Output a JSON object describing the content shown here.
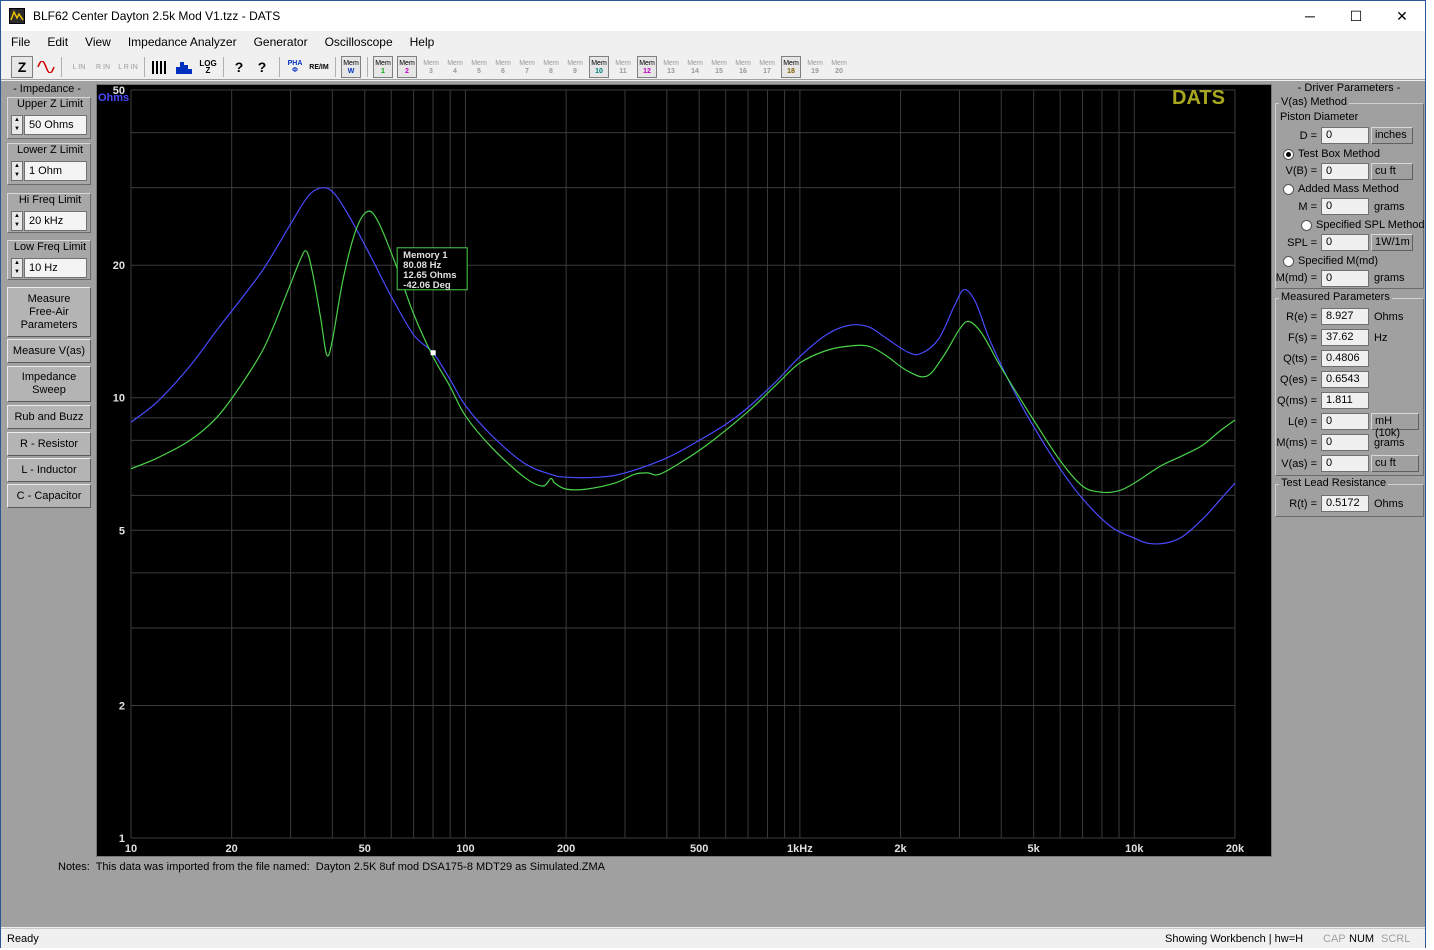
{
  "window": {
    "title": "BLF62 Center Dayton 2.5k Mod V1.tzz - DATS",
    "controls": {
      "minimize": "─",
      "maximize": "☐",
      "close": "✕"
    }
  },
  "menu": [
    "File",
    "Edit",
    "View",
    "Impedance Analyzer",
    "Generator",
    "Oscilloscope",
    "Help"
  ],
  "toolbar": {
    "z_label": "Z",
    "inputs": [
      "L IN",
      "R IN",
      "L R IN"
    ],
    "log_label": "LOG Z",
    "help_icons": [
      "?",
      "?"
    ],
    "pha_label": "PHA Φ",
    "re_im_label": "RE/IM",
    "mem_w": {
      "top": "Mem",
      "num": "W"
    },
    "mems": [
      {
        "top": "Mem",
        "num": "1",
        "active": true,
        "color": "#00a000"
      },
      {
        "top": "Mem",
        "num": "2",
        "active": true,
        "color": "#c000c0"
      },
      {
        "top": "Mem",
        "num": "3",
        "active": false,
        "color": "#9a9a9a"
      },
      {
        "top": "Mem",
        "num": "4",
        "active": false,
        "color": "#9a9a9a"
      },
      {
        "top": "Mem",
        "num": "5",
        "active": false,
        "color": "#9a9a9a"
      },
      {
        "top": "Mem",
        "num": "6",
        "active": false,
        "color": "#9a9a9a"
      },
      {
        "top": "Mem",
        "num": "7",
        "active": false,
        "color": "#9a9a9a"
      },
      {
        "top": "Mem",
        "num": "8",
        "active": false,
        "color": "#9a9a9a"
      },
      {
        "top": "Mem",
        "num": "9",
        "active": false,
        "color": "#9a9a9a"
      },
      {
        "top": "Mem",
        "num": "10",
        "active": true,
        "color": "#008080"
      },
      {
        "top": "Mem",
        "num": "11",
        "active": false,
        "color": "#9a9a9a"
      },
      {
        "top": "Mem",
        "num": "12",
        "active": true,
        "color": "#c000c0"
      },
      {
        "top": "Mem",
        "num": "13",
        "active": false,
        "color": "#9a9a9a"
      },
      {
        "top": "Mem",
        "num": "14",
        "active": false,
        "color": "#9a9a9a"
      },
      {
        "top": "Mem",
        "num": "15",
        "active": false,
        "color": "#9a9a9a"
      },
      {
        "top": "Mem",
        "num": "16",
        "active": false,
        "color": "#9a9a9a"
      },
      {
        "top": "Mem",
        "num": "17",
        "active": false,
        "color": "#9a9a9a"
      },
      {
        "top": "Mem",
        "num": "18",
        "active": true,
        "color": "#806000"
      },
      {
        "top": "Mem",
        "num": "19",
        "active": false,
        "color": "#9a9a9a"
      },
      {
        "top": "Mem",
        "num": "20",
        "active": false,
        "color": "#9a9a9a"
      }
    ]
  },
  "left_panel": {
    "header": "- Impedance -",
    "groups": [
      {
        "label": "Upper Z Limit",
        "value": "50 Ohms"
      },
      {
        "label": "Lower Z Limit",
        "value": "1 Ohm"
      },
      {
        "label": "Hi Freq Limit",
        "value": "20 kHz"
      },
      {
        "label": "Low Freq Limit",
        "value": "10 Hz"
      }
    ],
    "buttons": [
      "Measure Free-Air Parameters",
      "Measure V(as)",
      "Impedance Sweep",
      "Rub and Buzz",
      "R - Resistor",
      "L - Inductor",
      "C - Capacitor"
    ]
  },
  "right_panel": {
    "header": "- Driver Parameters -",
    "vas_method": {
      "legend": "V(as) Method",
      "piston_diameter_label": "Piston Diameter",
      "d_label": "D =",
      "d_value": "0",
      "d_unit": "inches",
      "test_box": "Test Box Method",
      "test_box_selected": true,
      "vb_label": "V(B) =",
      "vb_value": "0",
      "vb_unit": "cu ft",
      "added_mass": "Added Mass Method",
      "added_mass_selected": false,
      "m_label": "M =",
      "m_value": "0",
      "m_unit": "grams",
      "spl_method": "Specified SPL Method",
      "spl_selected": false,
      "spl_label": "SPL =",
      "spl_value": "0",
      "spl_unit": "1W/1m",
      "mmd_method": "Specified M(md)",
      "mmd_selected": false,
      "mmd_label": "M(md) =",
      "mmd_value": "0",
      "mmd_unit": "grams"
    },
    "measured": {
      "legend": "Measured Parameters",
      "rows": [
        {
          "label": "R(e) =",
          "value": "8.927",
          "unit": "Ohms",
          "unit_box": false
        },
        {
          "label": "F(s) =",
          "value": "37.62",
          "unit": "Hz",
          "unit_box": false
        },
        {
          "label": "Q(ts) =",
          "value": "0.4806",
          "unit": "",
          "unit_box": false
        },
        {
          "label": "Q(es) =",
          "value": "0.6543",
          "unit": "",
          "unit_box": false
        },
        {
          "label": "Q(ms) =",
          "value": "1.811",
          "unit": "",
          "unit_box": false
        },
        {
          "label": "L(e) =",
          "value": "0",
          "unit": "mH (10k)",
          "unit_box": true
        },
        {
          "label": "M(ms) =",
          "value": "0",
          "unit": "grams",
          "unit_box": false
        },
        {
          "label": "V(as) =",
          "value": "0",
          "unit": "cu ft",
          "unit_box": true
        }
      ]
    },
    "lead": {
      "legend": "Test Lead Resistance",
      "label": "R(t) =",
      "value": "0.5172",
      "unit": "Ohms"
    }
  },
  "notes": "Notes:  This data was imported from the file named:  Dayton 2.5K 8uf mod DSA175-8 MDT29 as Simulated.ZMA",
  "status": {
    "left": "Ready",
    "workbench": "Showing Workbench | hw=H",
    "indicators": [
      {
        "label": "CAP",
        "on": false
      },
      {
        "label": "NUM",
        "on": true
      },
      {
        "label": "SCRL",
        "on": false
      }
    ]
  },
  "chart_data": {
    "type": "line",
    "watermark": "DATS",
    "ylabel": "Ohms",
    "xscale": "log",
    "yscale": "log",
    "xlim": [
      10,
      20000
    ],
    "ylim": [
      1,
      50
    ],
    "x_ticks": [
      {
        "value": 10,
        "label": "10"
      },
      {
        "value": 20,
        "label": "20"
      },
      {
        "value": 50,
        "label": "50"
      },
      {
        "value": 100,
        "label": "100"
      },
      {
        "value": 200,
        "label": "200"
      },
      {
        "value": 500,
        "label": "500"
      },
      {
        "value": 1000,
        "label": "1kHz"
      },
      {
        "value": 2000,
        "label": "2k"
      },
      {
        "value": 5000,
        "label": "5k"
      },
      {
        "value": 10000,
        "label": "10k"
      },
      {
        "value": 20000,
        "label": "20k"
      }
    ],
    "y_ticks": [
      {
        "value": 1,
        "label": "1"
      },
      {
        "value": 2,
        "label": "2"
      },
      {
        "value": 5,
        "label": "5"
      },
      {
        "value": 10,
        "label": "10"
      },
      {
        "value": 20,
        "label": "20"
      },
      {
        "value": 50,
        "label": "50"
      }
    ],
    "grid": true,
    "series": [
      {
        "color": "#4a4aff",
        "points": [
          [
            10,
            8.8
          ],
          [
            12,
            9.8
          ],
          [
            15,
            11.8
          ],
          [
            18,
            14.2
          ],
          [
            21,
            16.5
          ],
          [
            25,
            19.7
          ],
          [
            30,
            24.8
          ],
          [
            34,
            28.8
          ],
          [
            37.6,
            30.0
          ],
          [
            41,
            28.8
          ],
          [
            46,
            25.0
          ],
          [
            52,
            21.0
          ],
          [
            60,
            17.0
          ],
          [
            70,
            13.9
          ],
          [
            80,
            12.65
          ],
          [
            90,
            11.0
          ],
          [
            100,
            9.6
          ],
          [
            120,
            8.2
          ],
          [
            150,
            7.1
          ],
          [
            180,
            6.7
          ],
          [
            200,
            6.6
          ],
          [
            250,
            6.6
          ],
          [
            300,
            6.75
          ],
          [
            400,
            7.3
          ],
          [
            500,
            8.0
          ],
          [
            600,
            8.7
          ],
          [
            700,
            9.5
          ],
          [
            850,
            10.9
          ],
          [
            1000,
            12.4
          ],
          [
            1200,
            13.9
          ],
          [
            1400,
            14.6
          ],
          [
            1600,
            14.5
          ],
          [
            1800,
            13.7
          ],
          [
            2100,
            12.7
          ],
          [
            2300,
            12.6
          ],
          [
            2600,
            13.6
          ],
          [
            2900,
            16.2
          ],
          [
            3100,
            17.6
          ],
          [
            3350,
            16.5
          ],
          [
            3700,
            13.5
          ],
          [
            4300,
            10.6
          ],
          [
            5000,
            8.6
          ],
          [
            6000,
            6.9
          ],
          [
            7000,
            5.9
          ],
          [
            8500,
            5.1
          ],
          [
            10000,
            4.8
          ],
          [
            11000,
            4.67
          ],
          [
            12500,
            4.68
          ],
          [
            14000,
            4.85
          ],
          [
            16000,
            5.3
          ],
          [
            18000,
            5.85
          ],
          [
            20000,
            6.4
          ]
        ]
      },
      {
        "color": "#4ad24a",
        "points": [
          [
            10,
            6.9
          ],
          [
            12,
            7.3
          ],
          [
            15,
            8.0
          ],
          [
            18,
            9.0
          ],
          [
            21,
            10.5
          ],
          [
            25,
            13.0
          ],
          [
            29,
            17.0
          ],
          [
            32,
            20.5
          ],
          [
            33.5,
            21.5
          ],
          [
            35,
            19.0
          ],
          [
            37,
            15.0
          ],
          [
            38.5,
            12.5
          ],
          [
            40,
            13.5
          ],
          [
            43,
            18.5
          ],
          [
            47,
            24.0
          ],
          [
            51,
            26.5
          ],
          [
            55,
            25.0
          ],
          [
            62,
            20.0
          ],
          [
            70,
            15.5
          ],
          [
            80,
            12.4
          ],
          [
            90,
            10.6
          ],
          [
            100,
            9.1
          ],
          [
            120,
            7.7
          ],
          [
            150,
            6.6
          ],
          [
            170,
            6.3
          ],
          [
            180,
            6.55
          ],
          [
            185,
            6.4
          ],
          [
            200,
            6.2
          ],
          [
            230,
            6.2
          ],
          [
            280,
            6.4
          ],
          [
            320,
            6.7
          ],
          [
            350,
            6.75
          ],
          [
            380,
            6.7
          ],
          [
            450,
            7.2
          ],
          [
            550,
            8.0
          ],
          [
            700,
            9.3
          ],
          [
            850,
            10.7
          ],
          [
            1000,
            12.0
          ],
          [
            1200,
            12.8
          ],
          [
            1400,
            13.1
          ],
          [
            1600,
            13.1
          ],
          [
            1800,
            12.5
          ],
          [
            2100,
            11.5
          ],
          [
            2400,
            11.2
          ],
          [
            2700,
            12.5
          ],
          [
            3000,
            14.3
          ],
          [
            3200,
            14.9
          ],
          [
            3500,
            14.0
          ],
          [
            4000,
            11.7
          ],
          [
            5000,
            8.9
          ],
          [
            6000,
            7.2
          ],
          [
            7000,
            6.3
          ],
          [
            8000,
            6.1
          ],
          [
            9000,
            6.15
          ],
          [
            10000,
            6.4
          ],
          [
            12000,
            7.0
          ],
          [
            14000,
            7.4
          ],
          [
            16000,
            7.8
          ],
          [
            18000,
            8.4
          ],
          [
            20000,
            8.9
          ]
        ]
      }
    ],
    "marker": {
      "x": 80.08,
      "y": 12.65,
      "lines": [
        "Memory 1",
        "80.08 Hz",
        "12.65 Ohms",
        "-42.06 Deg"
      ]
    }
  }
}
